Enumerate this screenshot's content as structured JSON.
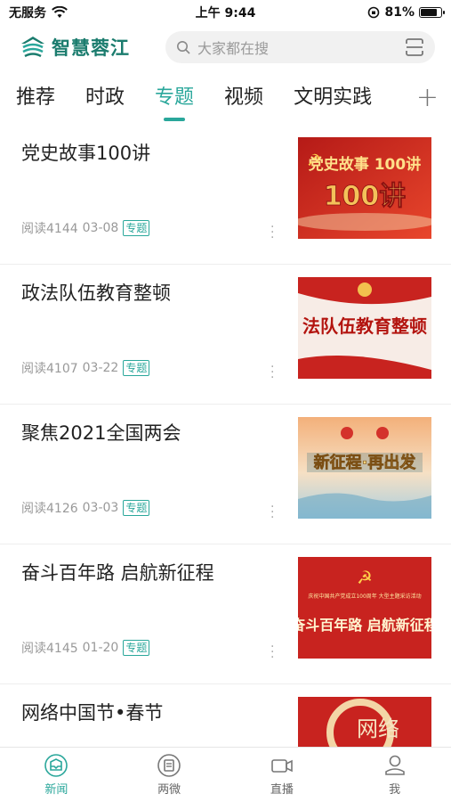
{
  "status_bar": {
    "carrier": "无服务",
    "time": "上午 9:44",
    "battery_percent": "81%",
    "battery_level": 0.81
  },
  "header": {
    "logo_text": "智慧蓉江",
    "search_placeholder": "大家都在搜"
  },
  "tabs": [
    {
      "label": "推荐",
      "active": false
    },
    {
      "label": "时政",
      "active": false
    },
    {
      "label": "专题",
      "active": true
    },
    {
      "label": "视频",
      "active": false
    },
    {
      "label": "文明实践",
      "active": false
    }
  ],
  "articles": [
    {
      "title": "党史故事100讲",
      "reads": "阅读4144",
      "date": "03-08",
      "tag": "专题",
      "thumb_text": "党史故事 100讲"
    },
    {
      "title": "政法队伍教育整顿",
      "reads": "阅读4107",
      "date": "03-22",
      "tag": "专题",
      "thumb_text": "法队伍教育整顿"
    },
    {
      "title": "聚焦2021全国两会",
      "reads": "阅读4126",
      "date": "03-03",
      "tag": "专题",
      "thumb_text": "新征程·再出发"
    },
    {
      "title": "奋斗百年路 启航新征程",
      "reads": "阅读4145",
      "date": "01-20",
      "tag": "专题",
      "thumb_text_small": "庆祝中国共产党成立100周年 大型主题采访活动",
      "thumb_text": "奋斗百年路 启航新征程"
    },
    {
      "title": "网络中国节•春节",
      "thumb_text": "网络"
    }
  ],
  "bottom_nav": [
    {
      "label": "新闻",
      "icon": "news-icon",
      "active": true
    },
    {
      "label": "两微",
      "icon": "weibo-wechat-icon",
      "active": false
    },
    {
      "label": "直播",
      "icon": "video-camera-icon",
      "active": false
    },
    {
      "label": "我",
      "icon": "user-icon",
      "active": false
    }
  ],
  "colors": {
    "accent": "#2aa79b",
    "brand": "#1b7c6e",
    "thumb_red": "#c8231f"
  }
}
